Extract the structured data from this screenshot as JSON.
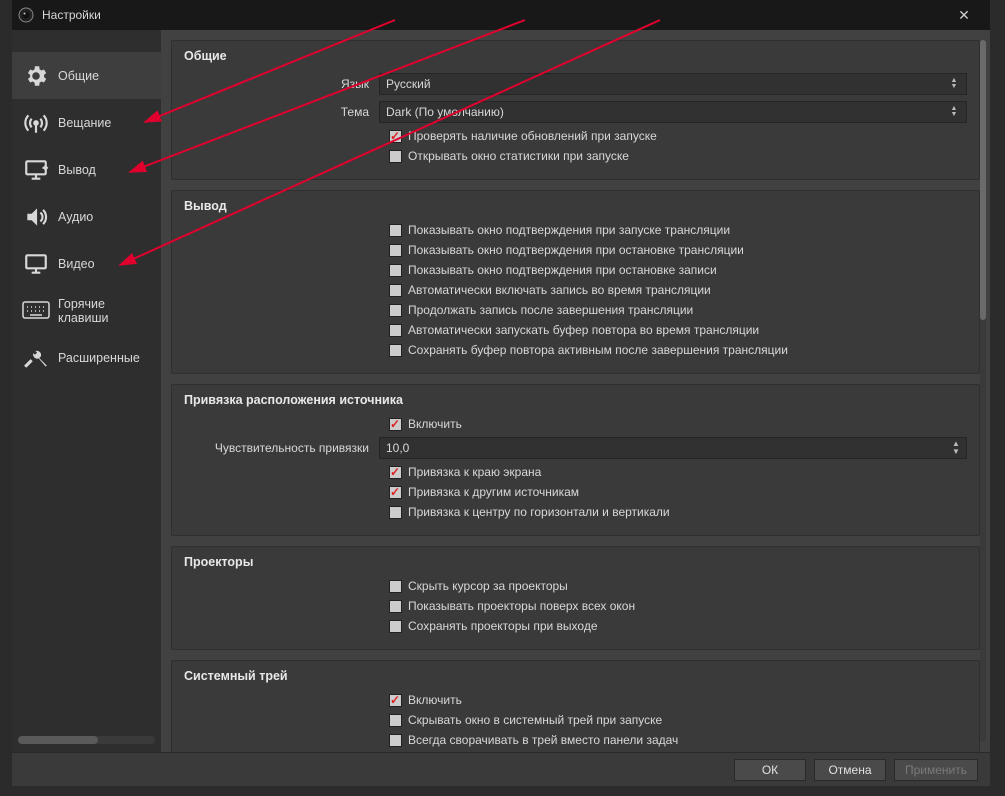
{
  "titlebar": {
    "title": "Настройки"
  },
  "sidebar": {
    "items": [
      {
        "label": "Общие"
      },
      {
        "label": "Вещание"
      },
      {
        "label": "Вывод"
      },
      {
        "label": "Аудио"
      },
      {
        "label": "Видео"
      },
      {
        "label": "Горячие клавиши"
      },
      {
        "label": "Расширенные"
      }
    ]
  },
  "groups": {
    "general": {
      "title": "Общие",
      "language_label": "Язык",
      "language_value": "Русский",
      "theme_label": "Тема",
      "theme_value": "Dark (По умолчанию)",
      "check_updates": "Проверять наличие обновлений при запуске",
      "open_stats": "Открывать окно статистики при запуске"
    },
    "output": {
      "title": "Вывод",
      "c1": "Показывать окно подтверждения при запуске трансляции",
      "c2": "Показывать окно подтверждения при остановке трансляции",
      "c3": "Показывать окно подтверждения при остановке записи",
      "c4": "Автоматически включать запись во время трансляции",
      "c5": "Продолжать запись после завершения трансляции",
      "c6": "Автоматически запускать буфер повтора во время трансляции",
      "c7": "Сохранять буфер повтора активным после завершения трансляции"
    },
    "snap": {
      "title": "Привязка расположения источника",
      "enable": "Включить",
      "sens_label": "Чувствительность привязки",
      "sens_value": "10,0",
      "edge": "Привязка к краю экрана",
      "other": "Привязка к другим источникам",
      "center": "Привязка к центру по горизонтали и вертикали"
    },
    "proj": {
      "title": "Проекторы",
      "c1": "Скрыть курсор за проекторы",
      "c2": "Показывать проекторы поверх всех окон",
      "c3": "Сохранять проекторы при выходе"
    },
    "tray": {
      "title": "Системный трей",
      "enable": "Включить",
      "c1": "Скрывать окно в системный трей при запуске",
      "c2": "Всегда сворачивать в трей вместо панели задач"
    }
  },
  "footer": {
    "ok": "ОК",
    "cancel": "Отмена",
    "apply": "Применить"
  }
}
